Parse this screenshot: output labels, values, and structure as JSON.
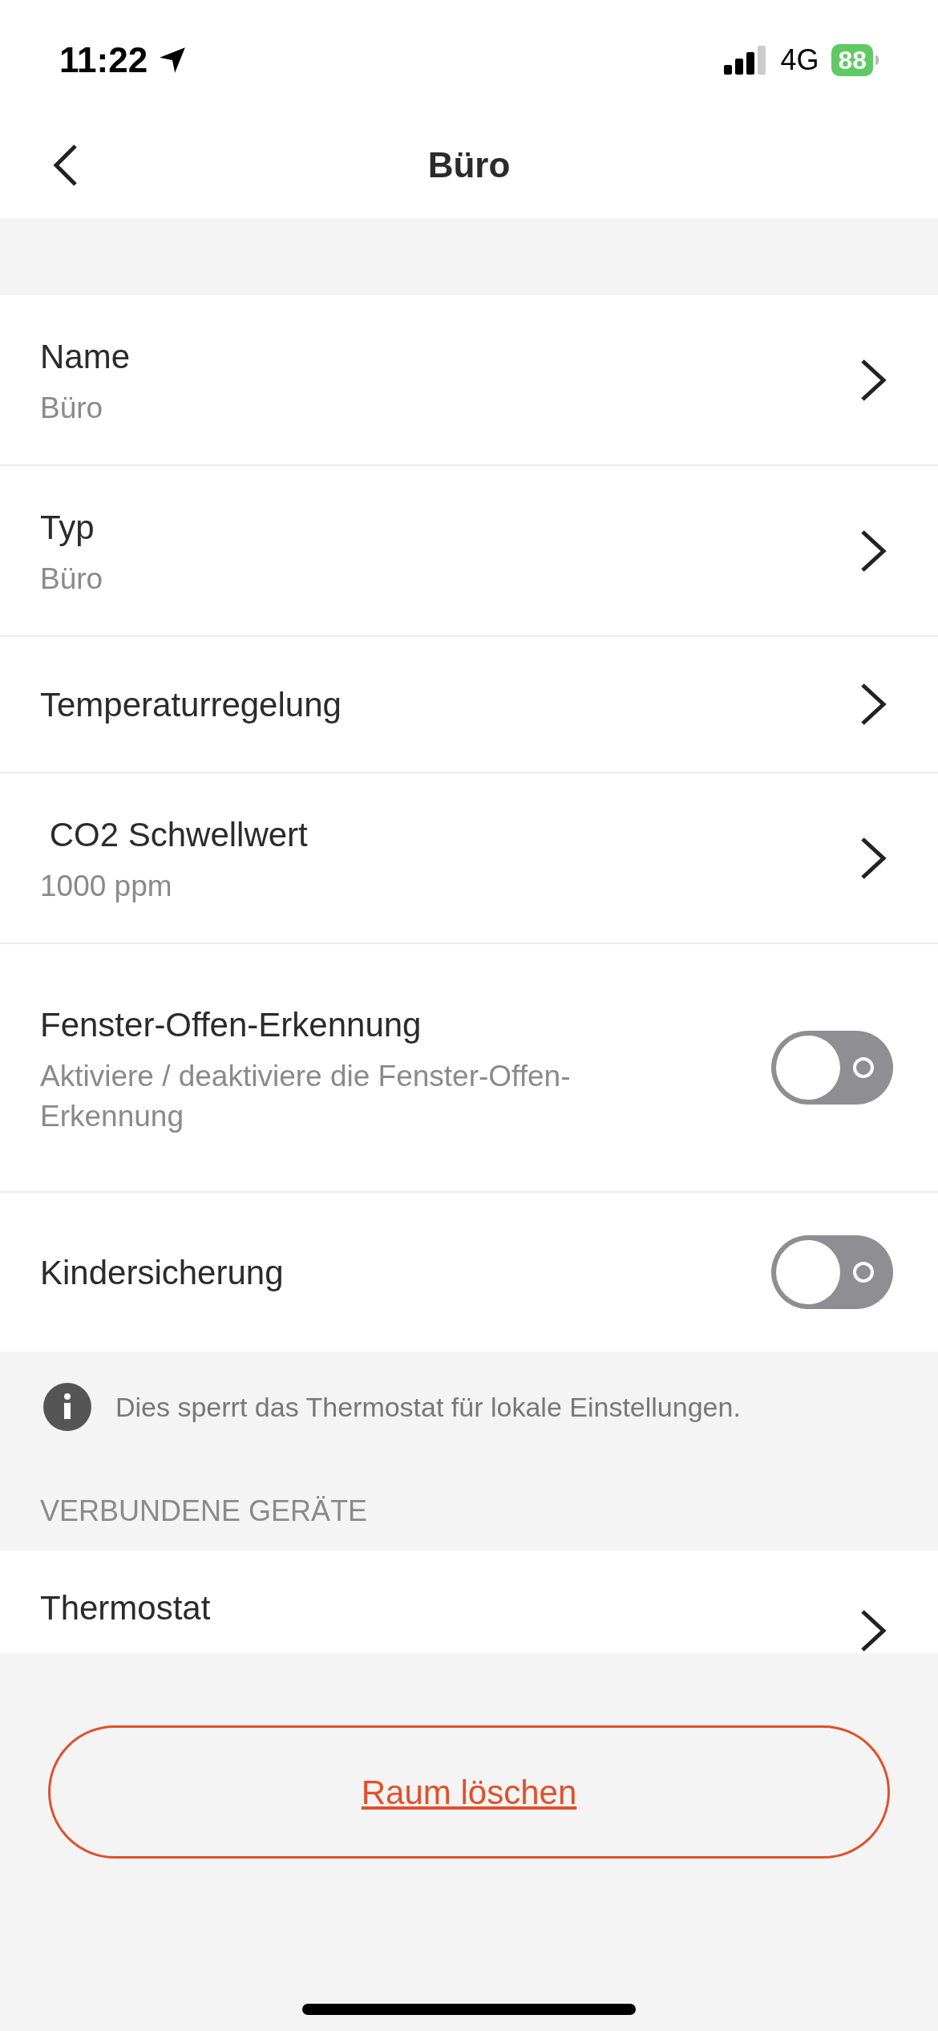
{
  "status_bar": {
    "time": "11:22",
    "network": "4G",
    "battery": "88"
  },
  "nav": {
    "title": "Büro"
  },
  "settings": [
    {
      "kind": "nav",
      "title": "Name",
      "subtitle": "Büro"
    },
    {
      "kind": "nav",
      "title": "Typ",
      "subtitle": "Büro"
    },
    {
      "kind": "nav",
      "title": "Temperaturregelung"
    },
    {
      "kind": "nav",
      "title": " CO2 Schwellwert",
      "subtitle": "1000 ppm"
    },
    {
      "kind": "toggle",
      "title": "Fenster-Offen-Erkennung",
      "subtitle": "Aktiviere / deaktiviere die Fenster-Offen-Erkennung",
      "on": false
    },
    {
      "kind": "toggle",
      "title": "Kindersicherung",
      "on": false
    }
  ],
  "info": "Dies sperrt das Thermostat für lokale Einstellungen.",
  "section_header": "VERBUNDENE GERÄTE",
  "devices": [
    {
      "title": "Thermostat"
    }
  ],
  "delete_button": "Raum löschen"
}
